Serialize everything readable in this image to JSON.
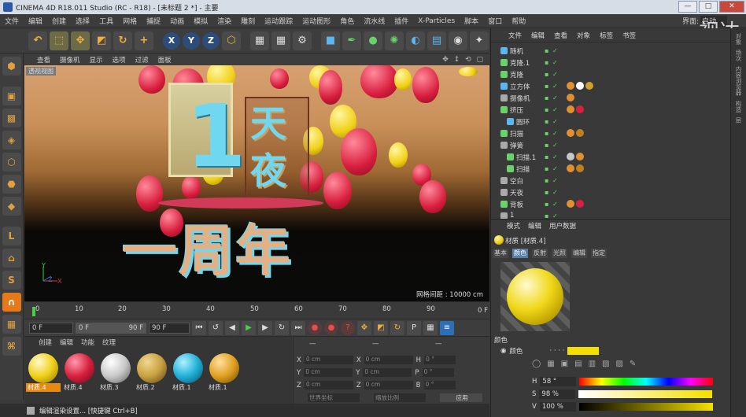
{
  "window": {
    "title": "CINEMA 4D R18.011 Studio (RC - R18) - [未标题 2 *] - 主要",
    "buttons": {
      "minimize": "—",
      "maximize": "□",
      "close": "✕"
    }
  },
  "menubar": {
    "items": [
      "文件",
      "编辑",
      "创建",
      "选择",
      "工具",
      "网格",
      "捕捉",
      "动画",
      "模拟",
      "渲染",
      "雕刻",
      "运动跟踪",
      "运动图形",
      "角色",
      "流水线",
      "插件",
      "X-Particles",
      "脚本",
      "窗口",
      "帮助"
    ],
    "layout_label": "界面:",
    "layout_value": "启动"
  },
  "watermark": "视达",
  "toolbar": {
    "axis_x": "X",
    "axis_y": "Y",
    "axis_z": "Z"
  },
  "viewport": {
    "menu": [
      "查看",
      "摄像机",
      "显示",
      "选项",
      "过滤",
      "面板"
    ],
    "label": "透视视图",
    "grid_label": "网格间距 : 10000 cm",
    "axes": {
      "x": "X",
      "y": "Y",
      "z": "Z"
    },
    "scene_text": {
      "one": "1",
      "day": "天",
      "night": "夜",
      "anniv": "一周年"
    }
  },
  "timeline": {
    "ticks": [
      "0",
      "10",
      "20",
      "30",
      "40",
      "50",
      "60",
      "70",
      "80",
      "90"
    ],
    "end_label": "0 F"
  },
  "transport": {
    "current_frame": "0 F",
    "range_start": "0 F",
    "range_end": "90 F",
    "max_frame": "90 F"
  },
  "material_manager": {
    "menu": [
      "创建",
      "编辑",
      "功能",
      "纹理"
    ],
    "materials": [
      {
        "name": "材质.4",
        "color": "#f0d018",
        "selected": true
      },
      {
        "name": "材质.4",
        "color": "#d82040",
        "selected": false
      },
      {
        "name": "材质.3",
        "color": "#c8c8c8",
        "selected": false
      },
      {
        "name": "材质.2",
        "color": "#c8a040",
        "selected": false
      },
      {
        "name": "材质.1",
        "color": "#20b0d8",
        "selected": false
      },
      {
        "name": "材质.1",
        "color": "#e0a020",
        "selected": false
      }
    ]
  },
  "coordinates": {
    "header_pos": "—",
    "header_size": "—",
    "header_rot": "—",
    "rows": [
      {
        "a": "X",
        "v1": "0 cm",
        "b": "X",
        "v2": "0 cm",
        "c": "H",
        "v3": "0 °"
      },
      {
        "a": "Y",
        "v1": "0 cm",
        "b": "Y",
        "v2": "0 cm",
        "c": "P",
        "v3": "0 °"
      },
      {
        "a": "Z",
        "v1": "0 cm",
        "b": "Z",
        "v2": "0 cm",
        "c": "B",
        "v3": "0 °"
      }
    ],
    "mode_world": "世界坐标",
    "mode_scale": "缩放比例",
    "apply": "应用"
  },
  "object_manager": {
    "menu": [
      "文件",
      "编辑",
      "查看",
      "对象",
      "标签",
      "书签"
    ],
    "objects": [
      {
        "name": "随机",
        "indent": 0,
        "icon": "#5db6f0",
        "tags": []
      },
      {
        "name": "克隆.1",
        "indent": 0,
        "icon": "#6ad26a",
        "tags": []
      },
      {
        "name": "克隆",
        "indent": 0,
        "icon": "#6ad26a",
        "tags": []
      },
      {
        "name": "立方体",
        "indent": 0,
        "icon": "#5db6f0",
        "tags": [
          "#e09030",
          "#ffffff",
          "#d0a030"
        ]
      },
      {
        "name": "摄像机",
        "indent": 0,
        "icon": "#aaaaaa",
        "tags": [
          "#e09030"
        ]
      },
      {
        "name": "挤压",
        "indent": 0,
        "icon": "#6ad26a",
        "tags": [
          "#e09030",
          "#d82040"
        ]
      },
      {
        "name": "圆环",
        "indent": 1,
        "icon": "#5db6f0",
        "tags": []
      },
      {
        "name": "扫描",
        "indent": 0,
        "icon": "#6ad26a",
        "tags": [
          "#e09030",
          "#c08020"
        ]
      },
      {
        "name": "弹簧",
        "indent": 0,
        "icon": "#aaaaaa",
        "tags": []
      },
      {
        "name": "扫描.1",
        "indent": 1,
        "icon": "#6ad26a",
        "tags": [
          "#c8c8c8",
          "#e09030"
        ]
      },
      {
        "name": "扫描",
        "indent": 1,
        "icon": "#6ad26a",
        "tags": [
          "#e09030",
          "#c08020"
        ]
      },
      {
        "name": "空白",
        "indent": 0,
        "icon": "#aaaaaa",
        "tags": []
      },
      {
        "name": "天夜",
        "indent": 0,
        "icon": "#aaaaaa",
        "tags": []
      },
      {
        "name": "背板",
        "indent": 0,
        "icon": "#6ad26a",
        "tags": [
          "#e09030",
          "#d82040"
        ]
      },
      {
        "name": "1",
        "indent": 0,
        "icon": "#aaaaaa",
        "tags": []
      }
    ]
  },
  "attribute_manager": {
    "menu": [
      "模式",
      "编辑",
      "用户数据"
    ],
    "title": "材质 [材质.4]",
    "tabs": [
      "基本",
      "颜色",
      "反射",
      "光照",
      "编辑",
      "指定"
    ],
    "active_tab": "颜色",
    "section": "颜色",
    "color_label": "颜色",
    "color_value": "#f4e000",
    "h": {
      "label": "H",
      "value": "58 °"
    },
    "s": {
      "label": "S",
      "value": "98 %"
    },
    "v": {
      "label": "V",
      "value": "100 %"
    }
  },
  "right_strip": [
    "对象",
    "场次",
    "内容浏览器",
    "构造",
    "层"
  ],
  "statusbar": {
    "text": "编辑渲染设置... [快捷键 Ctrl+B]"
  }
}
